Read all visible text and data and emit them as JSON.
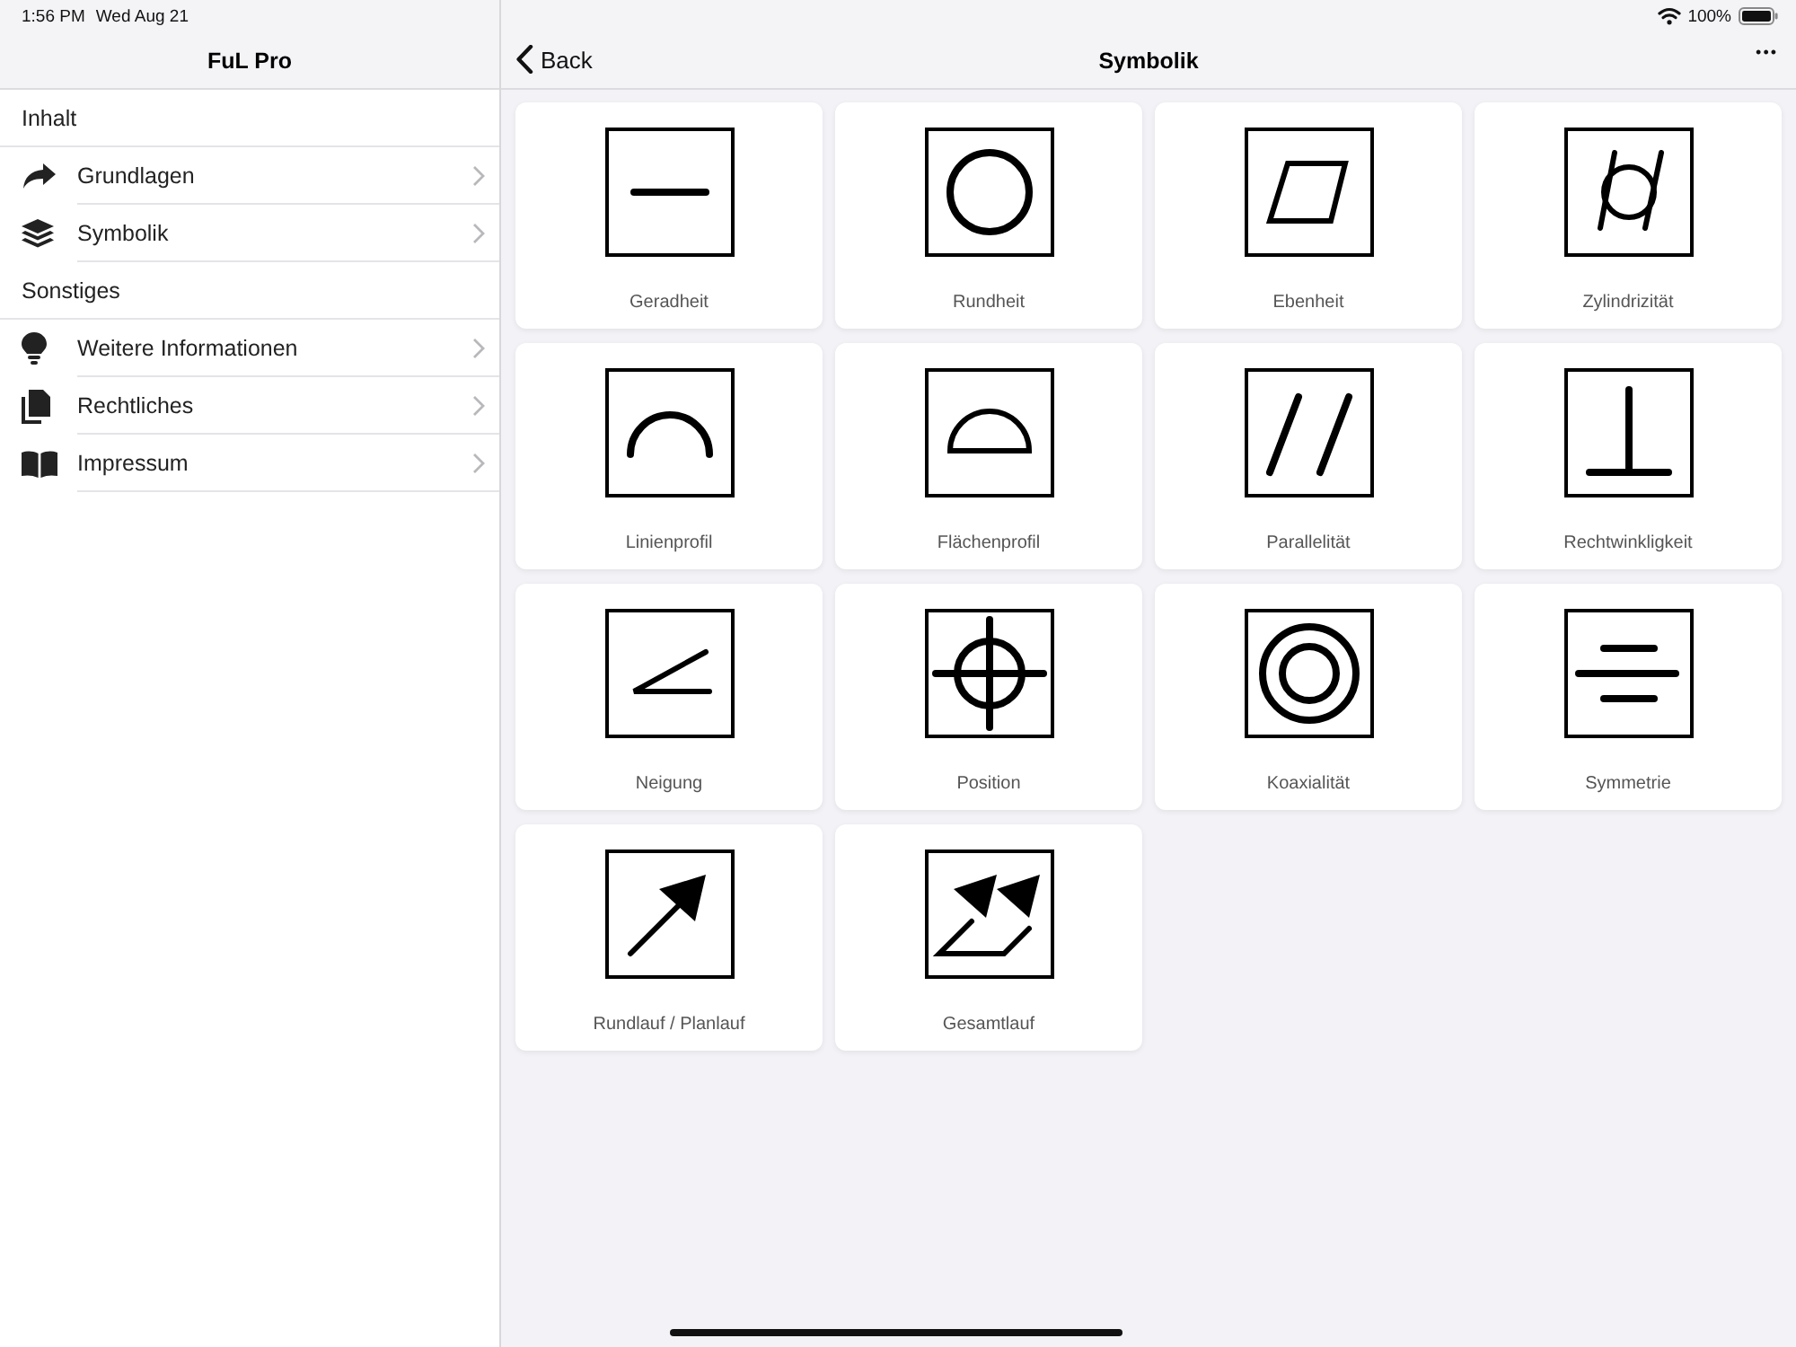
{
  "status_bar": {
    "time": "1:56 PM",
    "date": "Wed Aug 21",
    "battery": "100%"
  },
  "sidebar": {
    "title": "FuL Pro",
    "sections": [
      {
        "header": "Inhalt",
        "items": [
          {
            "label": "Grundlagen",
            "kind": "share"
          },
          {
            "label": "Symbolik",
            "kind": "layers"
          }
        ]
      },
      {
        "header": "Sonstiges",
        "items": [
          {
            "label": "Weitere Informationen",
            "kind": "bulb"
          },
          {
            "label": "Rechtliches",
            "kind": "documents"
          },
          {
            "label": "Impressum",
            "kind": "book"
          }
        ]
      }
    ]
  },
  "detail": {
    "back": "Back",
    "title": "Symbolik",
    "more": "•••",
    "symbols": [
      {
        "label": "Geradheit",
        "kind": "straightness"
      },
      {
        "label": "Rundheit",
        "kind": "roundness"
      },
      {
        "label": "Ebenheit",
        "kind": "flatness"
      },
      {
        "label": "Zylindrizität",
        "kind": "cylindricity"
      },
      {
        "label": "Linienprofil",
        "kind": "line-profile"
      },
      {
        "label": "Flächenprofil",
        "kind": "surface-profile"
      },
      {
        "label": "Parallelität",
        "kind": "parallelism"
      },
      {
        "label": "Rechtwinkligkeit",
        "kind": "perpendicularity"
      },
      {
        "label": "Neigung",
        "kind": "angularity"
      },
      {
        "label": "Position",
        "kind": "position"
      },
      {
        "label": "Koaxialität",
        "kind": "concentricity"
      },
      {
        "label": "Symmetrie",
        "kind": "symmetry"
      },
      {
        "label": "Rundlauf / Planlauf",
        "kind": "circular-runout"
      },
      {
        "label": "Gesamtlauf",
        "kind": "total-runout"
      }
    ]
  }
}
